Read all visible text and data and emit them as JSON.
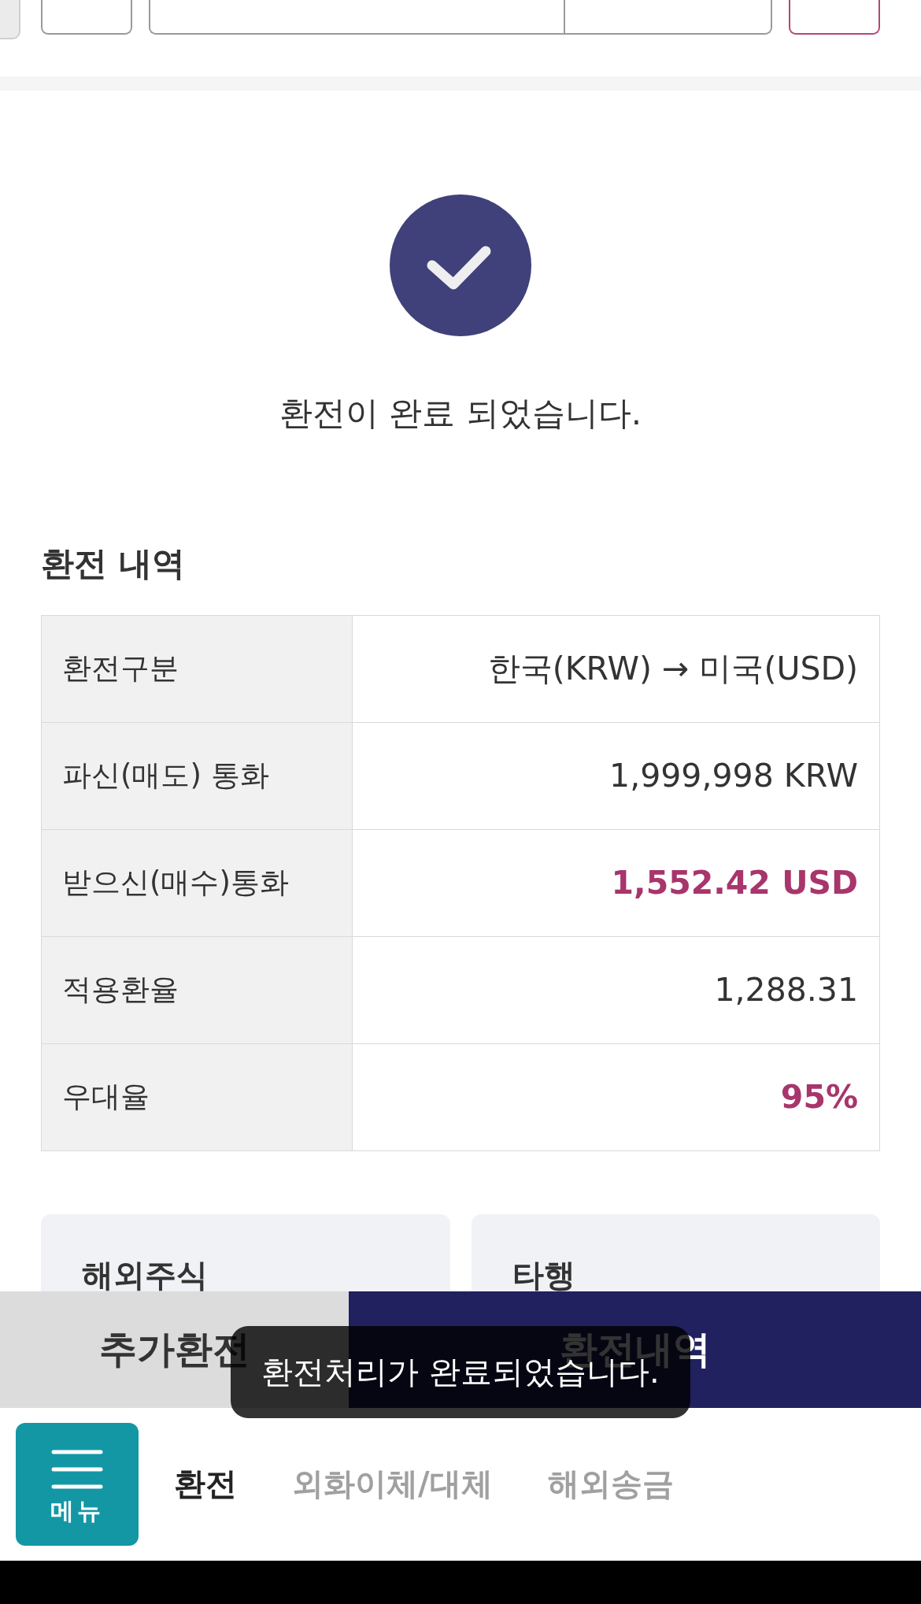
{
  "top_controls": [
    {
      "kind": "field"
    },
    {
      "kind": "field_group"
    },
    {
      "kind": "button"
    }
  ],
  "result": {
    "message": "환전이 완료 되었습니다."
  },
  "details": {
    "title": "환전 내역",
    "rows": [
      {
        "label": "환전구분",
        "value": "한국(KRW) → 미국(USD)",
        "highlight": false
      },
      {
        "label": "파신(매도) 통화",
        "value": "1,999,998 KRW",
        "highlight": false
      },
      {
        "label": "받으신(매수)통화",
        "value": "1,552.42 USD",
        "highlight": true
      },
      {
        "label": "적용환율",
        "value": "1,288.31",
        "highlight": false
      },
      {
        "label": "우대율",
        "value": "95%",
        "highlight": true
      }
    ]
  },
  "shortcuts": [
    {
      "label": "해외주식"
    },
    {
      "label": "타행"
    }
  ],
  "actions": [
    {
      "label": "추가환전",
      "kind": "secondary"
    },
    {
      "label": "환전내역",
      "kind": "primary"
    }
  ],
  "toast": {
    "message": "환전처리가 완료되었습니다."
  },
  "bottom_nav": {
    "menu_label": "메뉴",
    "tabs": [
      {
        "label": "환전",
        "selected": true
      },
      {
        "label": "외화이체/대체",
        "selected": false
      },
      {
        "label": "해외송금",
        "selected": false
      }
    ]
  }
}
